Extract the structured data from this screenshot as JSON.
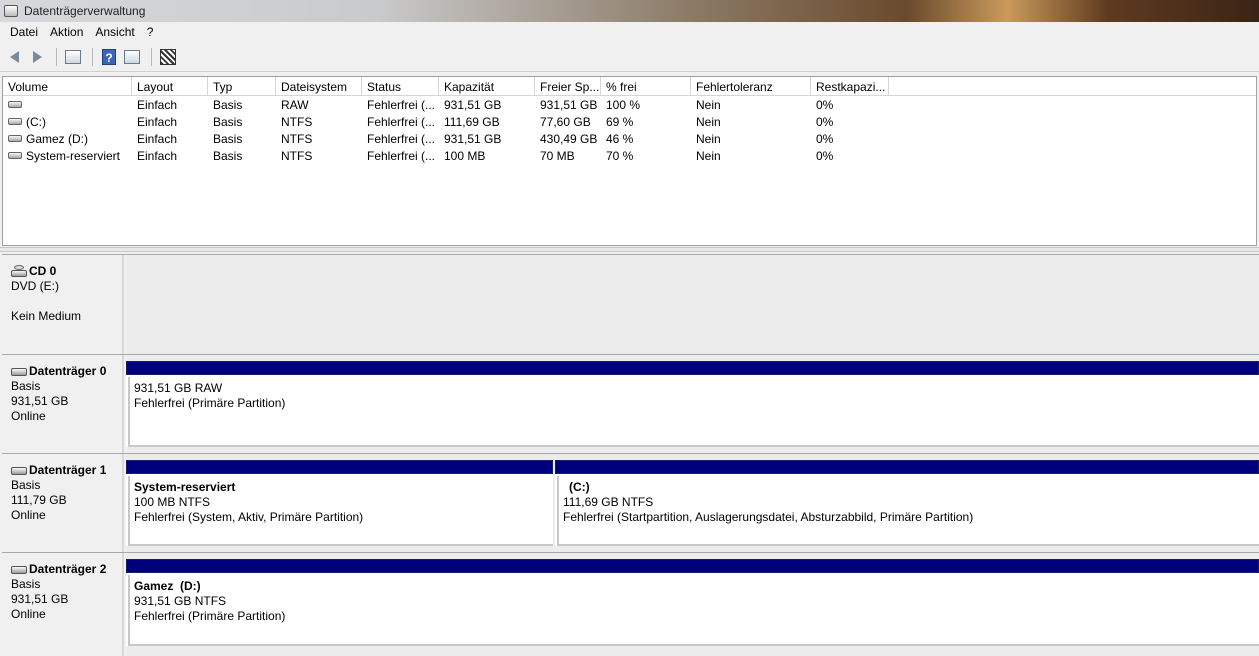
{
  "window": {
    "title": "Datenträgerverwaltung"
  },
  "menu": [
    {
      "label": "Datei"
    },
    {
      "label": "Aktion"
    },
    {
      "label": "Ansicht"
    },
    {
      "label": "?"
    }
  ],
  "toolbar": {
    "icons": [
      "back-arrow-icon",
      "forward-arrow-icon",
      "console-tree-icon",
      "help-icon",
      "list-view-icon",
      "properties-icon"
    ]
  },
  "volume_list": {
    "columns": [
      "Volume",
      "Layout",
      "Typ",
      "Dateisystem",
      "Status",
      "Kapazität",
      "Freier Sp...",
      "% frei",
      "Fehlertoleranz",
      "Restkapazi..."
    ],
    "rows": [
      {
        "volume": "",
        "layout": "Einfach",
        "typ": "Basis",
        "dateisystem": "RAW",
        "status": "Fehlerfrei (...",
        "kapazitaet": "931,51 GB",
        "frei": "931,51 GB",
        "prozent": "100 %",
        "fehlertoleranz": "Nein",
        "rest": "0%"
      },
      {
        "volume": "(C:)",
        "layout": "Einfach",
        "typ": "Basis",
        "dateisystem": "NTFS",
        "status": "Fehlerfrei (...",
        "kapazitaet": "111,69 GB",
        "frei": "77,60 GB",
        "prozent": "69 %",
        "fehlertoleranz": "Nein",
        "rest": "0%"
      },
      {
        "volume": "Gamez (D:)",
        "layout": "Einfach",
        "typ": "Basis",
        "dateisystem": "NTFS",
        "status": "Fehlerfrei (...",
        "kapazitaet": "931,51 GB",
        "frei": "430,49 GB",
        "prozent": "46 %",
        "fehlertoleranz": "Nein",
        "rest": "0%"
      },
      {
        "volume": "System-reserviert",
        "layout": "Einfach",
        "typ": "Basis",
        "dateisystem": "NTFS",
        "status": "Fehlerfrei (...",
        "kapazitaet": "100 MB",
        "frei": "70 MB",
        "prozent": "70 %",
        "fehlertoleranz": "Nein",
        "rest": "0%"
      }
    ]
  },
  "disks": {
    "cd0": {
      "name": "CD 0",
      "line1": "DVD (E:)",
      "line3": "Kein Medium"
    },
    "disk0": {
      "name": "Datenträger 0",
      "type": "Basis",
      "size": "931,51 GB",
      "state": "Online",
      "partitions": [
        {
          "name": "",
          "size": "931,51 GB RAW",
          "status": "Fehlerfrei (Primäre Partition)"
        }
      ]
    },
    "disk1": {
      "name": "Datenträger 1",
      "type": "Basis",
      "size": "111,79 GB",
      "state": "Online",
      "partitions": [
        {
          "name": "System-reserviert",
          "size": "100 MB NTFS",
          "status": "Fehlerfrei (System, Aktiv, Primäre Partition)"
        },
        {
          "name": "(C:)",
          "size": "111,69 GB NTFS",
          "status": "Fehlerfrei (Startpartition, Auslagerungsdatei, Absturzabbild, Primäre Partition)"
        }
      ]
    },
    "disk2": {
      "name": "Datenträger 2",
      "type": "Basis",
      "size": "931,51 GB",
      "state": "Online",
      "partitions": [
        {
          "name": "Gamez  (D:)",
          "size": "931,51 GB NTFS",
          "status": "Fehlerfrei (Primäre Partition)"
        }
      ]
    }
  },
  "colors": {
    "partition_bar": "#00007f",
    "list_bg": "#ffffff",
    "window_bg": "#f0f0f0"
  }
}
